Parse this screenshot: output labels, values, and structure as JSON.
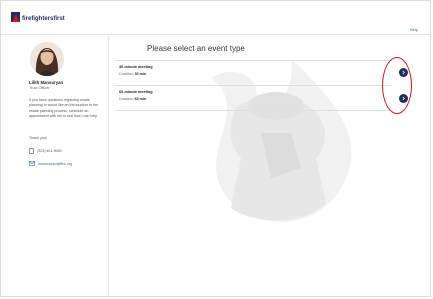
{
  "header": {
    "logo_text": "firefightersfirst",
    "help_label": "Help"
  },
  "sidebar": {
    "name": "Lilith Mansuryan",
    "title": "Trust Officer",
    "description": "If you have questions regarding estate planning or would like an introduction to the estate planning process, schedule an appointment with me to see how I can help.",
    "thanks": "Thank you!",
    "phone": "(323) 401-9040",
    "email": "lmansuryan@ffcu.org"
  },
  "main": {
    "title": "Please select an event type",
    "duration_label": "Duration:",
    "events": [
      {
        "name": "30-minute meeting",
        "duration": "30 min"
      },
      {
        "name": "60-minute meeting",
        "duration": "60 min"
      }
    ]
  },
  "colors": {
    "accent": "#1c2f5e",
    "link": "#2f6fc0",
    "annotation": "#d3171b"
  },
  "icons": [
    "logo-icon",
    "phone-icon",
    "email-icon",
    "chevron-right-icon"
  ]
}
